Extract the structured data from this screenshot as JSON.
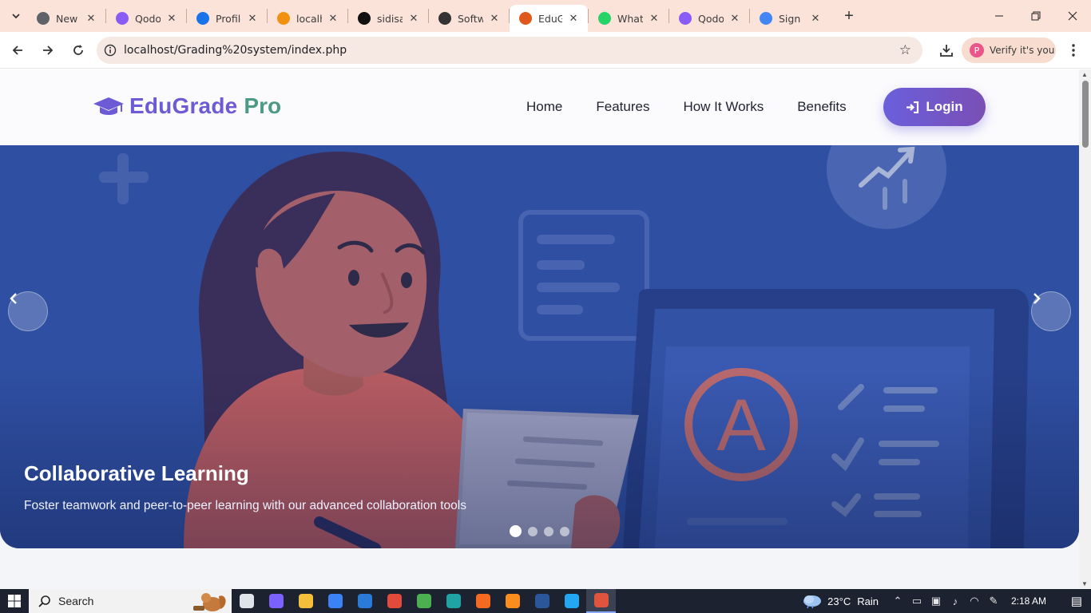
{
  "browser": {
    "tabs": [
      {
        "title": "New Ta",
        "favicon": "chrome-icon",
        "color": "#5f6368",
        "active": false
      },
      {
        "title": "Qodo",
        "favicon": "qodo-icon",
        "color": "#8a5cf6",
        "active": false
      },
      {
        "title": "Profile",
        "favicon": "profile-a-icon",
        "color": "#1a73e8",
        "active": false
      },
      {
        "title": "localho",
        "favicon": "phpmyadmin-icon",
        "color": "#f29111",
        "active": false
      },
      {
        "title": "sidisam",
        "favicon": "github-icon",
        "color": "#111111",
        "active": false
      },
      {
        "title": "Softwar",
        "favicon": "openai-icon",
        "color": "#333333",
        "active": false
      },
      {
        "title": "EduGra",
        "favicon": "edugrade-icon",
        "color": "#e0581b",
        "active": true
      },
      {
        "title": "WhatsA",
        "favicon": "whatsapp-icon",
        "color": "#25d366",
        "active": false
      },
      {
        "title": "Qodo",
        "favicon": "qodo-icon",
        "color": "#8a5cf6",
        "active": false
      },
      {
        "title": "Sign in",
        "favicon": "google-icon",
        "color": "#4285f4",
        "active": false
      }
    ],
    "url": "localhost/Grading%20system/index.php",
    "verify_label": "Verify it's you",
    "profile_initial": "P"
  },
  "site": {
    "brand_main": "EduGrade",
    "brand_accent": "Pro",
    "nav": [
      "Home",
      "Features",
      "How It Works",
      "Benefits"
    ],
    "login_label": "Login",
    "hero": {
      "title": "Collaborative Learning",
      "subtitle": "Foster teamwork and peer-to-peer learning with our advanced collaboration tools",
      "slide_count": 4,
      "active_slide": 1,
      "grade_letter": "A"
    }
  },
  "taskbar": {
    "search_label": "Search",
    "weather_temp": "23°C",
    "weather_desc": "Rain",
    "time": "2:18 AM",
    "apps": [
      {
        "name": "task-view-icon",
        "color": "#dfe3ea"
      },
      {
        "name": "copilot-icon",
        "color": "#7b61ff"
      },
      {
        "name": "file-explorer-icon",
        "color": "#f4c03c"
      },
      {
        "name": "microsoft-store-icon",
        "color": "#3b82f6"
      },
      {
        "name": "mail-icon",
        "color": "#2a7bd8"
      },
      {
        "name": "app-icon",
        "color": "#e24b3b"
      },
      {
        "name": "chrome-icon",
        "color": "#4caf50"
      },
      {
        "name": "edge-icon",
        "color": "#1fa3a5"
      },
      {
        "name": "xampp-icon",
        "color": "#f56a21"
      },
      {
        "name": "brave-icon",
        "color": "#fb8c1e"
      },
      {
        "name": "word-icon",
        "color": "#2b579a"
      },
      {
        "name": "vscode-icon",
        "color": "#22a7f2"
      },
      {
        "name": "chrome-active-icon",
        "color": "#e0533d"
      }
    ]
  },
  "colors": {
    "brand_purple": "#6c5bd4",
    "brand_green": "#4c9a86",
    "hero_blue": "#2f4fa2"
  }
}
